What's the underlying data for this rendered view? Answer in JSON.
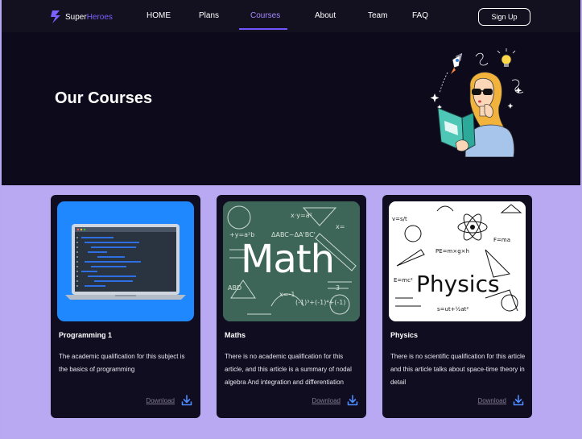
{
  "nav": {
    "logo": {
      "part1": "Super",
      "part2": "Heroes"
    },
    "links": [
      "HOME",
      "Plans",
      "Courses",
      "About",
      "Team",
      "FAQ"
    ],
    "active": "Courses",
    "signup_label": "Sign Up"
  },
  "hero": {
    "title": "Our Courses"
  },
  "courses": [
    {
      "title": "Programming 1",
      "description": "The academic qualification for this subject is the basics of programming",
      "download_label": "Download",
      "image_icon": "laptop-code-illustration"
    },
    {
      "title": "Maths",
      "description": "There is no academic qualification for this article, and this article is a summary of nodal algebra And integration and differentiation",
      "download_label": "Download",
      "image_icon": "chalkboard-math-illustration",
      "image_text": "Math"
    },
    {
      "title": "Physics",
      "description": "There is no scientific qualification for this article and this article talks about space-time theory in detail",
      "download_label": "Download",
      "image_icon": "physics-doodle-illustration",
      "image_text": "Physics"
    }
  ],
  "colors": {
    "accent": "#6f56ff",
    "dark_bg": "#0d0a1c",
    "lavender": "#b9a9f3",
    "card_bg": "#110d20",
    "download_icon": "#4d8bff"
  }
}
